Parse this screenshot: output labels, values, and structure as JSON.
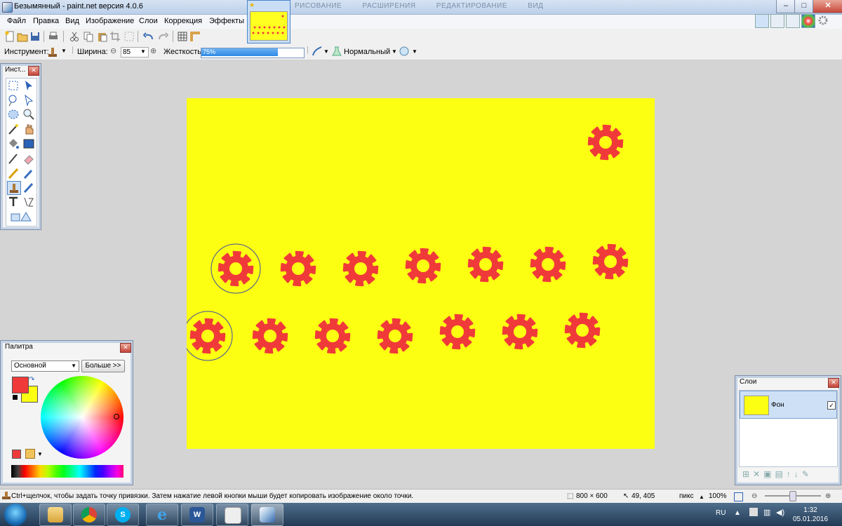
{
  "window": {
    "title": "Безымянный - paint.net версия 4.0.6",
    "ghost_tabs": [
      "РИСОВАНИЕ",
      "РАСШИРЕНИЯ",
      "РЕДАКТИРОВАНИЕ",
      "ВИД"
    ],
    "controls": {
      "minimize": "–",
      "maximize": "□",
      "close": "✕"
    }
  },
  "menu": [
    "Файл",
    "Правка",
    "Вид",
    "Изображение",
    "Слои",
    "Коррекция",
    "Эффекты"
  ],
  "options_bar": {
    "tool_label": "Инструмент:",
    "width_label": "Ширина:",
    "width_value": "85",
    "hardness_label": "Жесткость:",
    "hardness_value": "75%",
    "hardness_fraction": 0.75,
    "blend_mode": "Нормальный"
  },
  "tools_panel": {
    "title": "Инст..."
  },
  "palette_panel": {
    "title": "Палитра",
    "mode": "Основной",
    "more_button": "Больше >>",
    "primary_color": "#f03a3a",
    "secondary_color": "#fdff12"
  },
  "layers_panel": {
    "title": "Слои",
    "layers": [
      {
        "name": "Фон",
        "visible": true
      }
    ]
  },
  "canvas": {
    "background": "#fdff12",
    "gear_color": "#f03a3a"
  },
  "status": {
    "hint": "Ctrl+щелчок, чтобы задать точку привязки. Затем нажатие левой кнопки мыши будет копировать изображение около точки.",
    "image_size": "800 × 600",
    "cursor_pos": "49, 405",
    "units": "пикс",
    "zoom": "100%"
  },
  "tray": {
    "lang": "RU",
    "time": "1:32",
    "date": "05.01.2016"
  }
}
